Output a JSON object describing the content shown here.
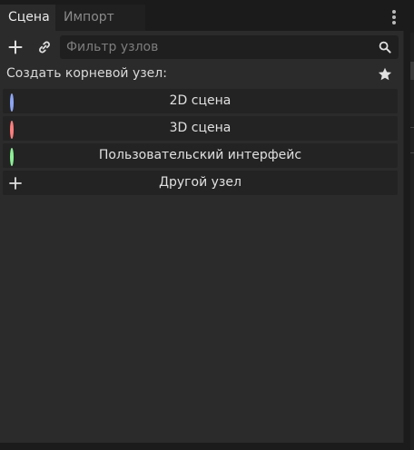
{
  "tabs": [
    {
      "label": "Сцена",
      "active": true
    },
    {
      "label": "Импорт",
      "active": false
    }
  ],
  "search": {
    "placeholder": "Фильтр узлов",
    "value": ""
  },
  "header": {
    "label": "Создать корневой узел:"
  },
  "options": [
    {
      "label": "2D сцена",
      "icon": "circle-2d-icon",
      "color": "#8da5f3"
    },
    {
      "label": "3D сцена",
      "icon": "circle-3d-icon",
      "color": "#fc7f7f"
    },
    {
      "label": "Пользовательский интерфейс",
      "icon": "circle-ui-icon",
      "color": "#8eef97"
    },
    {
      "label": "Другой узел",
      "icon": "plus-icon",
      "color": "#e0e0e0"
    }
  ]
}
